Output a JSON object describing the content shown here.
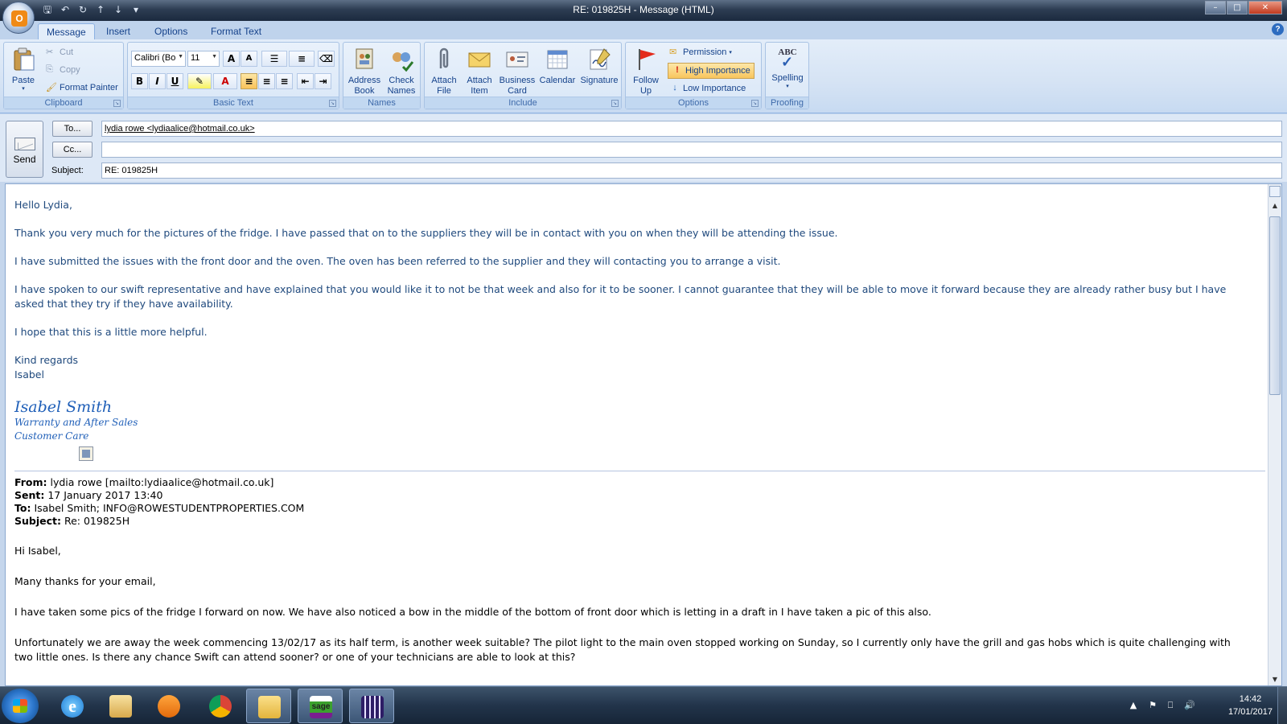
{
  "window": {
    "title": "RE: 019825H - Message (HTML)",
    "office_button_letter": "O"
  },
  "ribbon": {
    "tabs": [
      "Message",
      "Insert",
      "Options",
      "Format Text"
    ],
    "clipboard": {
      "label": "Clipboard",
      "paste": "Paste",
      "cut": "Cut",
      "copy": "Copy",
      "format_painter": "Format Painter"
    },
    "basic_text": {
      "label": "Basic Text",
      "font_name": "Calibri (Bo",
      "font_size": "11",
      "bold": "B",
      "italic": "I",
      "underline": "U",
      "grow_font": "A",
      "shrink_font": "A",
      "font_color": "A"
    },
    "names": {
      "label": "Names",
      "address_book": "Address Book",
      "check_names": "Check Names"
    },
    "include": {
      "label": "Include",
      "attach_file": "Attach File",
      "attach_item": "Attach Item",
      "business_card": "Business Card",
      "calendar": "Calendar",
      "signature": "Signature"
    },
    "options": {
      "label": "Options",
      "follow_up": "Follow Up",
      "permission": "Permission",
      "high_importance": "High Importance",
      "low_importance": "Low Importance"
    },
    "proofing": {
      "label": "Proofing",
      "spelling": "Spelling",
      "abc": "ABC"
    },
    "accent_color": "#15428b"
  },
  "header": {
    "send": "Send",
    "to_button": "To...",
    "cc_button": "Cc...",
    "subject_label": "Subject:",
    "to_value": "lydia rowe <lydiaalice@hotmail.co.uk>",
    "cc_value": "",
    "subject_value": "RE: 019825H"
  },
  "body": {
    "greeting": "Hello Lydia,",
    "para1": "Thank you very much for the pictures of the fridge. I have passed that on to the suppliers they will be in contact with you on when they will be attending the issue.",
    "para2": "I have submitted the issues with the front door and the oven. The oven has been referred to the supplier and they will contacting you to arrange a visit.",
    "para3": "I have spoken to our swift representative and have explained that you would like it to not be that week and also for it to be sooner. I cannot guarantee that they will be able to move it forward because they are already rather busy but I have asked that they try if they have availability.",
    "para4": "I hope that this is a little more helpful.",
    "closing": "Kind regards",
    "closing_name": "Isabel",
    "signature": {
      "name": "Isabel Smith",
      "line1": "Warranty and After Sales",
      "line2": "Customer Care"
    },
    "reply_color": "#1f497d",
    "original": {
      "from_label": "From:",
      "from_value": "lydia rowe [mailto:lydiaalice@hotmail.co.uk]",
      "sent_label": "Sent:",
      "sent_value": "17 January 2017 13:40",
      "to_label": "To:",
      "to_value": "Isabel Smith; INFO@ROWESTUDENTPROPERTIES.COM",
      "subject_label": "Subject:",
      "subject_value": "Re: 019825H",
      "greeting": "Hi Isabel,",
      "para1": "Many thanks for your email,",
      "para2": "I have taken some pics of the fridge I forward on now. We have also noticed a bow in the middle of the bottom of front door which is letting in a draft in I have taken a pic of this also.",
      "para3": "Unfortunately we are away the week commencing 13/02/17 as its half term, is another week suitable?  The pilot light to the main oven stopped working on Sunday, so I currently only have the grill and gas hobs which is quite challenging with two little ones. Is there any chance Swift can attend  sooner? or one of your technicians are able to look at this?"
    }
  },
  "taskbar": {
    "items": [
      "internet-explorer",
      "file-explorer",
      "media-player",
      "chrome",
      "outlook",
      "sage",
      "app-grid"
    ],
    "time": "14:42",
    "date": "17/01/2017"
  }
}
